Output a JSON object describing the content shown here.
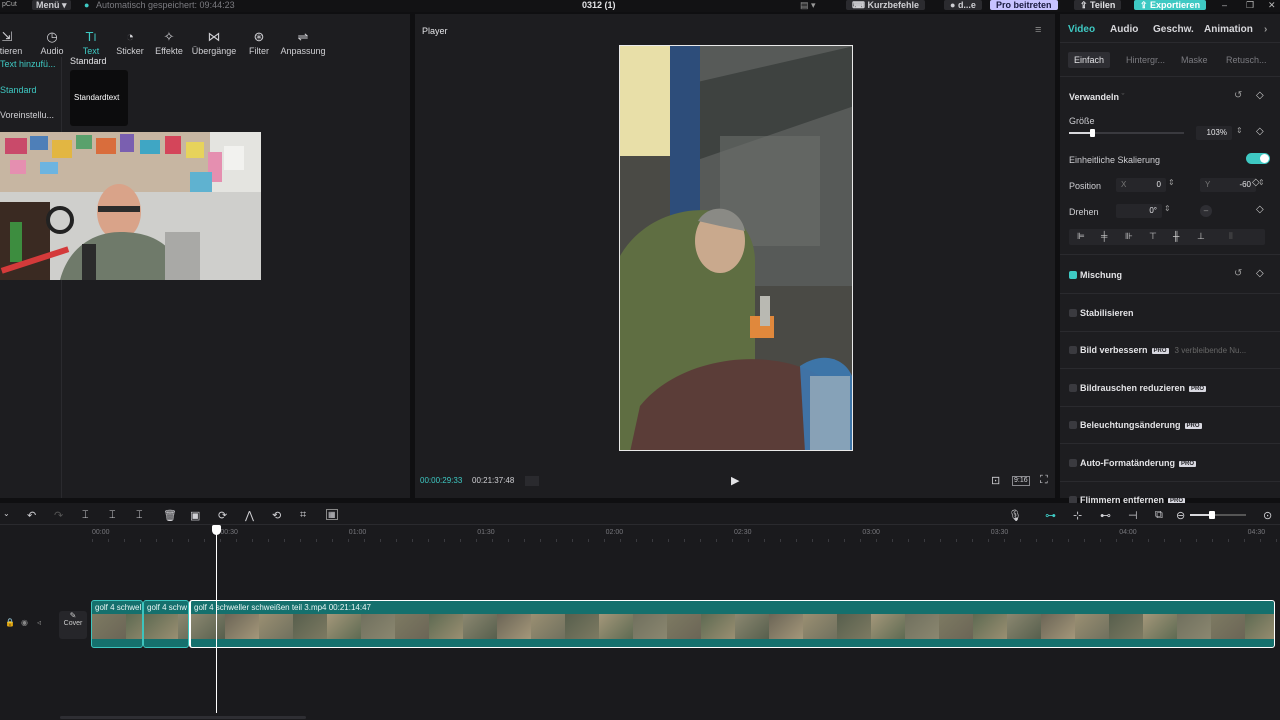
{
  "topbar": {
    "app_name": "pCut",
    "menu_label": "Menü",
    "autosave": "Automatisch gespeichert: 09:44:23",
    "project_title": "0312 (1)",
    "shortcuts_label": "Kurzbefehle",
    "user_label": "d...e",
    "pro_label": "Pro beitreten",
    "share_label": "Teilen",
    "export_label": "Exportieren"
  },
  "toolbar": {
    "items": [
      {
        "label": "ortieren",
        "icon": "import-icon"
      },
      {
        "label": "Audio",
        "icon": "audio-icon"
      },
      {
        "label": "Text",
        "icon": "text-icon"
      },
      {
        "label": "Sticker",
        "icon": "sticker-icon"
      },
      {
        "label": "Effekte",
        "icon": "effects-icon"
      },
      {
        "label": "Übergänge",
        "icon": "transitions-icon"
      },
      {
        "label": "Filter",
        "icon": "filter-icon"
      },
      {
        "label": "Anpassung",
        "icon": "adjust-icon"
      }
    ]
  },
  "leftnav": {
    "items": [
      "Text hinzufü...",
      "Standard",
      "Voreinstellu..."
    ]
  },
  "textpanel": {
    "heading": "Standard",
    "preset_label": "Standardtext"
  },
  "player": {
    "title": "Player",
    "current_time": "00:00:29:33",
    "total_time": "00:21:37:48",
    "aspect_label": "9:16"
  },
  "rightpanel": {
    "tabs": [
      "Video",
      "Audio",
      "Geschw.",
      "Animation"
    ],
    "subtabs": [
      "Einfach",
      "Hintergr...",
      "Maske",
      "Retusch..."
    ],
    "transform": {
      "title": "Verwandeln",
      "size_label": "Größe",
      "size_value": "103%",
      "size_fraction": 0.2,
      "uniform_label": "Einheitliche Skalierung",
      "position_label": "Position",
      "x_label": "X",
      "x_value": "0",
      "y_label": "Y",
      "y_value": "-60",
      "rotate_label": "Drehen",
      "rotate_value": "0°"
    },
    "sections": [
      {
        "label": "Mischung",
        "checked": true,
        "badge": "",
        "note": ""
      },
      {
        "label": "Stabilisieren",
        "checked": false,
        "badge": "",
        "note": ""
      },
      {
        "label": "Bild verbessern",
        "checked": false,
        "badge": "PRO",
        "note": "3 verbleibende Nu..."
      },
      {
        "label": "Bildrauschen reduzieren",
        "checked": false,
        "badge": "PRO",
        "note": ""
      },
      {
        "label": "Beleuchtungsänderung",
        "checked": false,
        "badge": "PRO",
        "note": ""
      },
      {
        "label": "Auto-Formatänderung",
        "checked": false,
        "badge": "PRO",
        "note": ""
      },
      {
        "label": "Flimmern entfernen",
        "checked": false,
        "badge": "PRO",
        "note": ""
      }
    ]
  },
  "timeline": {
    "ruler": [
      "00:00",
      "00:30",
      "01:00",
      "01:30",
      "02:00",
      "02:30",
      "03:00",
      "03:30",
      "04:00",
      "04:30"
    ],
    "cover_label": "Cover",
    "clips": [
      {
        "label": "golf 4 schwel"
      },
      {
        "label": "golf 4 schw"
      },
      {
        "label": "golf 4 schweller schweißen teil 3.mp4   00:21:14:47"
      }
    ]
  },
  "colors": {
    "accent": "#3ec9c3",
    "pro_badge": "#c7c2ff",
    "clip_fill": "#15706d"
  }
}
